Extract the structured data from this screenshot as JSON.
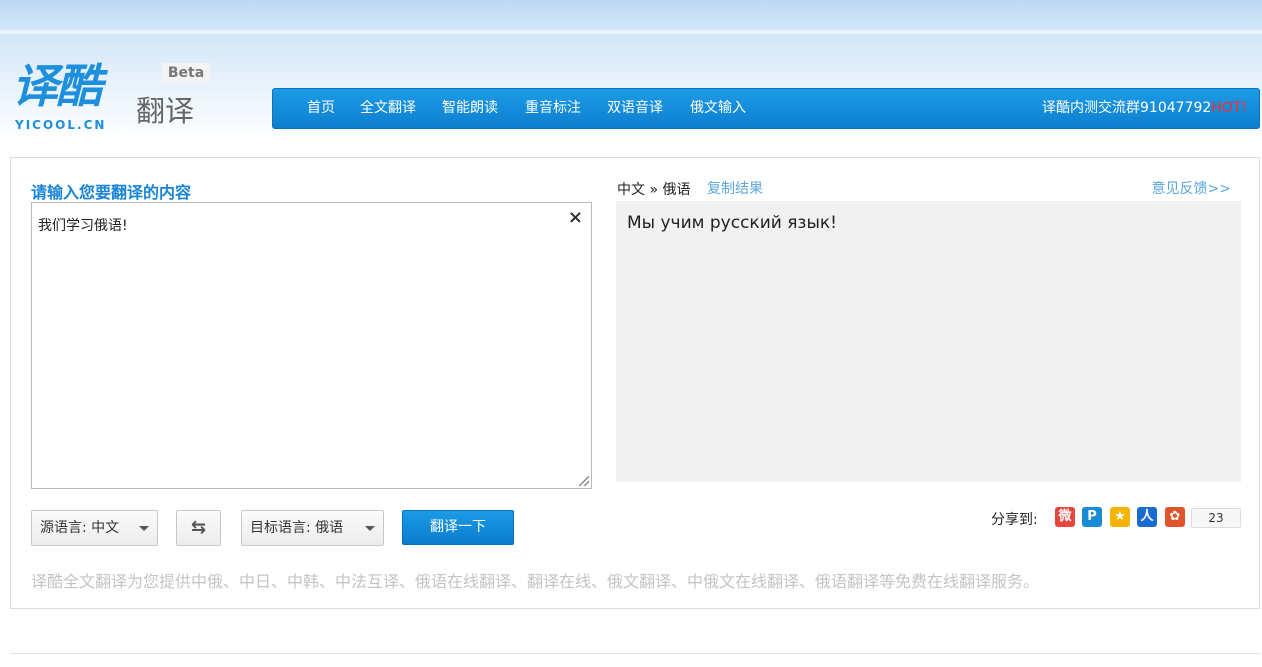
{
  "logo": {
    "main": "译酷",
    "sub": "翻译",
    "domain": "YICOOL.CN",
    "beta": "Beta"
  },
  "nav": {
    "items": [
      "首页",
      "全文翻译",
      "智能朗读",
      "重音标注",
      "双语音译",
      "俄文输入"
    ],
    "qq_label": "译酷内测交流群91047792",
    "hot": "HOT!"
  },
  "input": {
    "title": "请输入您要翻译的内容",
    "value": "我们学习俄语!",
    "clear_icon": "×"
  },
  "result": {
    "source_lang": "中文",
    "separator": "»",
    "target_lang": "俄语",
    "copy_label": "复制结果",
    "feedback_label": "意见反馈>>",
    "text": "Мы учим русский язык!"
  },
  "controls": {
    "source_select": "源语言:  中文",
    "target_select": "目标语言:  俄语",
    "translate_label": "翻译一下",
    "swap_icon": "⇆"
  },
  "share": {
    "label": "分享到:",
    "count": "23",
    "icons": [
      {
        "name": "weibo-icon",
        "color": "#e8453c",
        "glyph": "微"
      },
      {
        "name": "qzone-icon",
        "color": "#1a8bd6",
        "glyph": "P"
      },
      {
        "name": "qq-star-icon",
        "color": "#f5b400",
        "glyph": "★"
      },
      {
        "name": "renren-icon",
        "color": "#1a6bd0",
        "glyph": "人"
      },
      {
        "name": "kaixin-icon",
        "color": "#e0542b",
        "glyph": "✿"
      }
    ]
  },
  "description": "译酷全文翻译为您提供中俄、中日、中韩、中法互译、俄语在线翻译、翻译在线、俄文翻译、中俄文在线翻译、俄语翻译等免费在线翻译服务。"
}
